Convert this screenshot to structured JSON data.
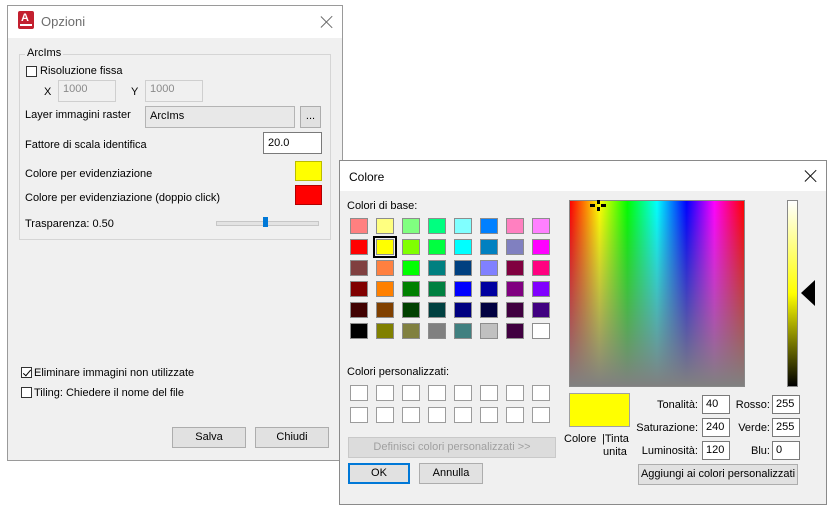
{
  "opzioni": {
    "title": "Opzioni",
    "group_label": "ArcIms",
    "fixed_resolution_label": "Risoluzione fissa",
    "x_label": "X",
    "x_value": "1000",
    "y_label": "Y",
    "y_value": "1000",
    "raster_layer_label": "Layer immagini raster",
    "raster_layer_value": "ArcIms",
    "browse_label": "...",
    "scale_factor_label": "Fattore di scala identifica",
    "scale_factor_value": "20.0",
    "highlight_color_label": "Colore per evidenziazione",
    "highlight_color": "#ffff00",
    "highlight_dbl_label": "Colore per evidenziazione (doppio click)",
    "highlight_dbl_color": "#ff0000",
    "transparency_label": "Trasparenza: 0.50",
    "transparency_value": 0.5,
    "remove_unused_label": "Eliminare immagini non utilizzate",
    "remove_unused_checked": true,
    "tiling_label": "Tiling: Chiedere il nome del file",
    "tiling_checked": false,
    "save_label": "Salva",
    "close_label": "Chiudi"
  },
  "colore": {
    "title": "Colore",
    "basic_colors_label": "Colori di base:",
    "basic_colors": [
      [
        "#ff8080",
        "#ffff80",
        "#80ff80",
        "#00ff80",
        "#80ffff",
        "#0080ff",
        "#ff80c0",
        "#ff80ff"
      ],
      [
        "#ff0000",
        "#ffff00",
        "#80ff00",
        "#00ff40",
        "#00ffff",
        "#0080c0",
        "#8080c0",
        "#ff00ff"
      ],
      [
        "#804040",
        "#ff8040",
        "#00ff00",
        "#008080",
        "#004080",
        "#8080ff",
        "#800040",
        "#ff0080"
      ],
      [
        "#800000",
        "#ff8000",
        "#008000",
        "#008040",
        "#0000ff",
        "#0000a0",
        "#800080",
        "#8000ff"
      ],
      [
        "#400000",
        "#804000",
        "#004000",
        "#004040",
        "#000080",
        "#000040",
        "#400040",
        "#400080"
      ],
      [
        "#000000",
        "#808000",
        "#808040",
        "#808080",
        "#408080",
        "#c0c0c0",
        "#400040",
        "#ffffff"
      ]
    ],
    "custom_colors_label": "Colori personalizzati:",
    "define_custom_label": "Definisci colori personalizzati >>",
    "ok_label": "OK",
    "cancel_label": "Annulla",
    "color_solid_label_1": "Colore",
    "color_solid_label_2": "|Tinta",
    "color_solid_label_3": "unita",
    "hue_label": "Tonalità:",
    "hue_value": "40",
    "sat_label": "Saturazione:",
    "sat_value": "240",
    "lum_label": "Luminosità:",
    "lum_value": "120",
    "red_label": "Rosso:",
    "red_value": "255",
    "green_label": "Verde:",
    "green_value": "255",
    "blue_label": "Blu:",
    "blue_value": "0",
    "add_custom_label": "Aggiungi ai colori personalizzati",
    "current_color": "#ffff00"
  }
}
